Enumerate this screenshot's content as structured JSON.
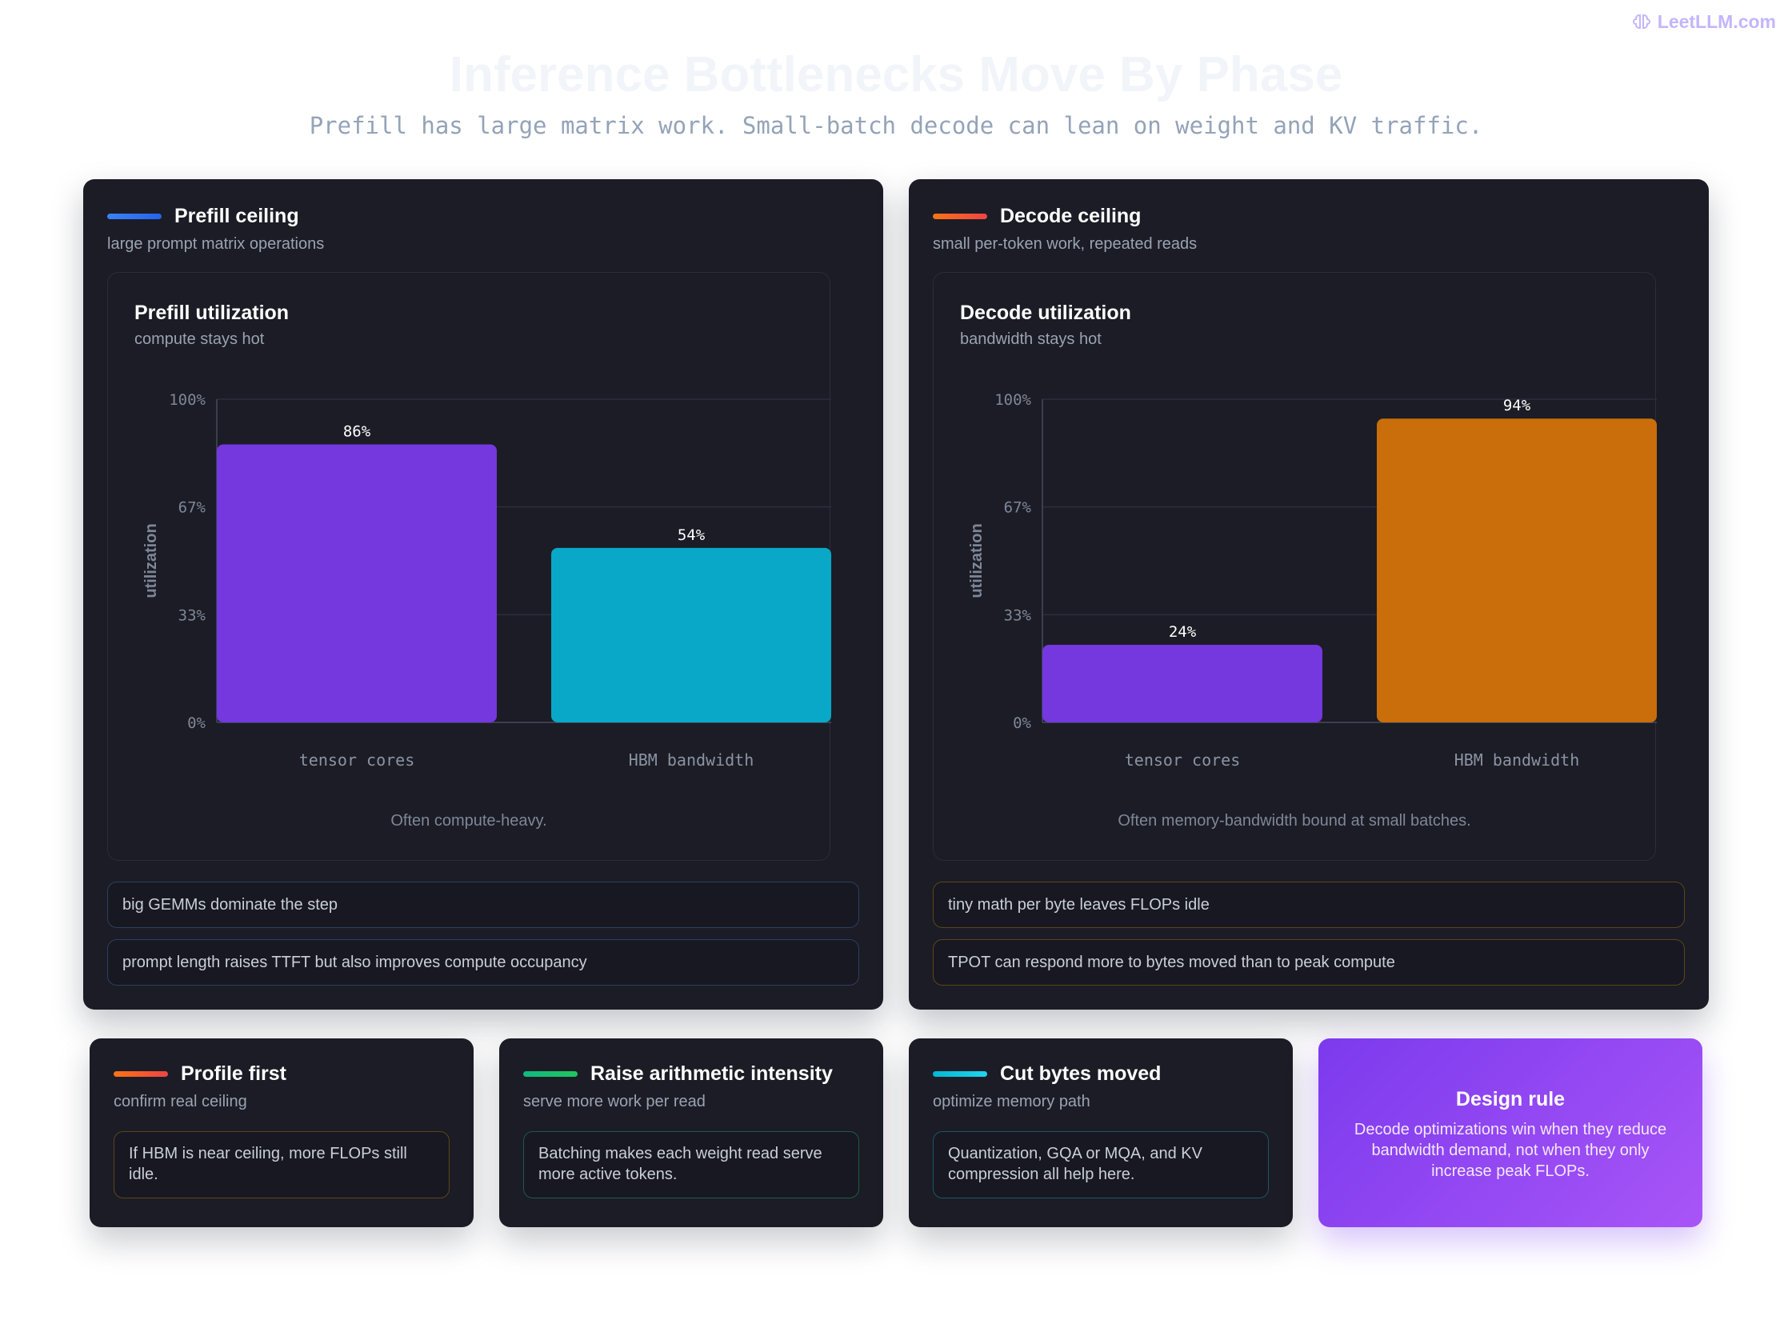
{
  "brand": "LeetLLM.com",
  "title": "Inference Bottlenecks Move By Phase",
  "subtitle": "Prefill has large matrix work. Small-batch decode can lean on weight and KV traffic.",
  "colors": {
    "prefill_accent": "#3b82f6",
    "decode_accent": "#f97316",
    "tensor_bar": "#7537de",
    "hbm_prefill": "#09a8c8",
    "hbm_decode": "#c96e0b",
    "design_rule": "#7c3aed"
  },
  "prefill": {
    "title": "Prefill ceiling",
    "subtitle": "large prompt matrix operations",
    "chart_title": "Prefill utilization",
    "chart_subtitle": "compute stays hot",
    "note": "Often compute-heavy.",
    "pills": [
      "big GEMMs dominate the step",
      "prompt length raises TTFT but also improves compute occupancy"
    ]
  },
  "decode": {
    "title": "Decode ceiling",
    "subtitle": "small per-token work, repeated reads",
    "chart_title": "Decode utilization",
    "chart_subtitle": "bandwidth stays hot",
    "note": "Often memory-bandwidth bound at small batches.",
    "pills": [
      "tiny math per byte leaves FLOPs idle",
      "TPOT can respond more to bytes moved than to peak compute"
    ]
  },
  "chart_data": [
    {
      "type": "bar",
      "title": "Prefill utilization",
      "subtitle": "compute stays hot",
      "categories": [
        "tensor cores",
        "HBM bandwidth"
      ],
      "values": [
        86,
        54
      ],
      "value_labels": [
        "86%",
        "54%"
      ],
      "colors": [
        "#7537de",
        "#09a8c8"
      ],
      "ylabel": "utilization",
      "yticks": [
        "0%",
        "33%",
        "67%",
        "100%"
      ],
      "ylim": [
        0,
        100
      ],
      "grid": true
    },
    {
      "type": "bar",
      "title": "Decode utilization",
      "subtitle": "bandwidth stays hot",
      "categories": [
        "tensor cores",
        "HBM bandwidth"
      ],
      "values": [
        24,
        94
      ],
      "value_labels": [
        "24%",
        "94%"
      ],
      "colors": [
        "#7537de",
        "#c96e0b"
      ],
      "ylabel": "utilization",
      "yticks": [
        "0%",
        "33%",
        "67%",
        "100%"
      ],
      "ylim": [
        0,
        100
      ],
      "grid": true
    }
  ],
  "cards": [
    {
      "title": "Profile first",
      "subtitle": "confirm real ceiling",
      "text": "If HBM is near ceiling, more FLOPs still idle."
    },
    {
      "title": "Raise arithmetic intensity",
      "subtitle": "serve more work per read",
      "text": "Batching makes each weight read serve more active tokens."
    },
    {
      "title": "Cut bytes moved",
      "subtitle": "optimize memory path",
      "text": "Quantization, GQA or MQA, and KV compression all help here."
    }
  ],
  "design_rule": {
    "title": "Design rule",
    "text": "Decode optimizations win when they reduce bandwidth demand, not when they only increase peak FLOPs."
  }
}
